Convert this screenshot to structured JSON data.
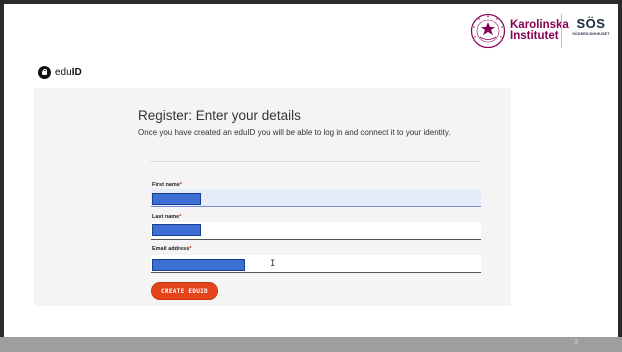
{
  "slide": {
    "page_number": "3"
  },
  "logos": {
    "ki_line1": "Karolinska",
    "ki_line2": "Institutet",
    "sos_main": "SÖS",
    "sos_sub": "SÖDERSJUKHUSET",
    "ki_color": "#870052"
  },
  "eduid": {
    "brand_light": "edu",
    "brand_bold": "ID"
  },
  "form": {
    "heading": "Register: Enter your details",
    "lead": "Once you have created an eduID you will be able to log in and connect it to your identity.",
    "fields": [
      {
        "label": "First name",
        "required_mark": "*",
        "value": "",
        "state": "focused-redacted"
      },
      {
        "label": "Last name",
        "required_mark": "*",
        "value": "",
        "state": "redacted"
      },
      {
        "label": "Email address",
        "required_mark": "*",
        "value": "",
        "state": "redacted"
      }
    ],
    "submit_label": "CREATE EDUID",
    "accent_color": "#e3441c",
    "redaction_color": "#3c6fd3"
  },
  "cursor": {
    "glyph": "I"
  }
}
